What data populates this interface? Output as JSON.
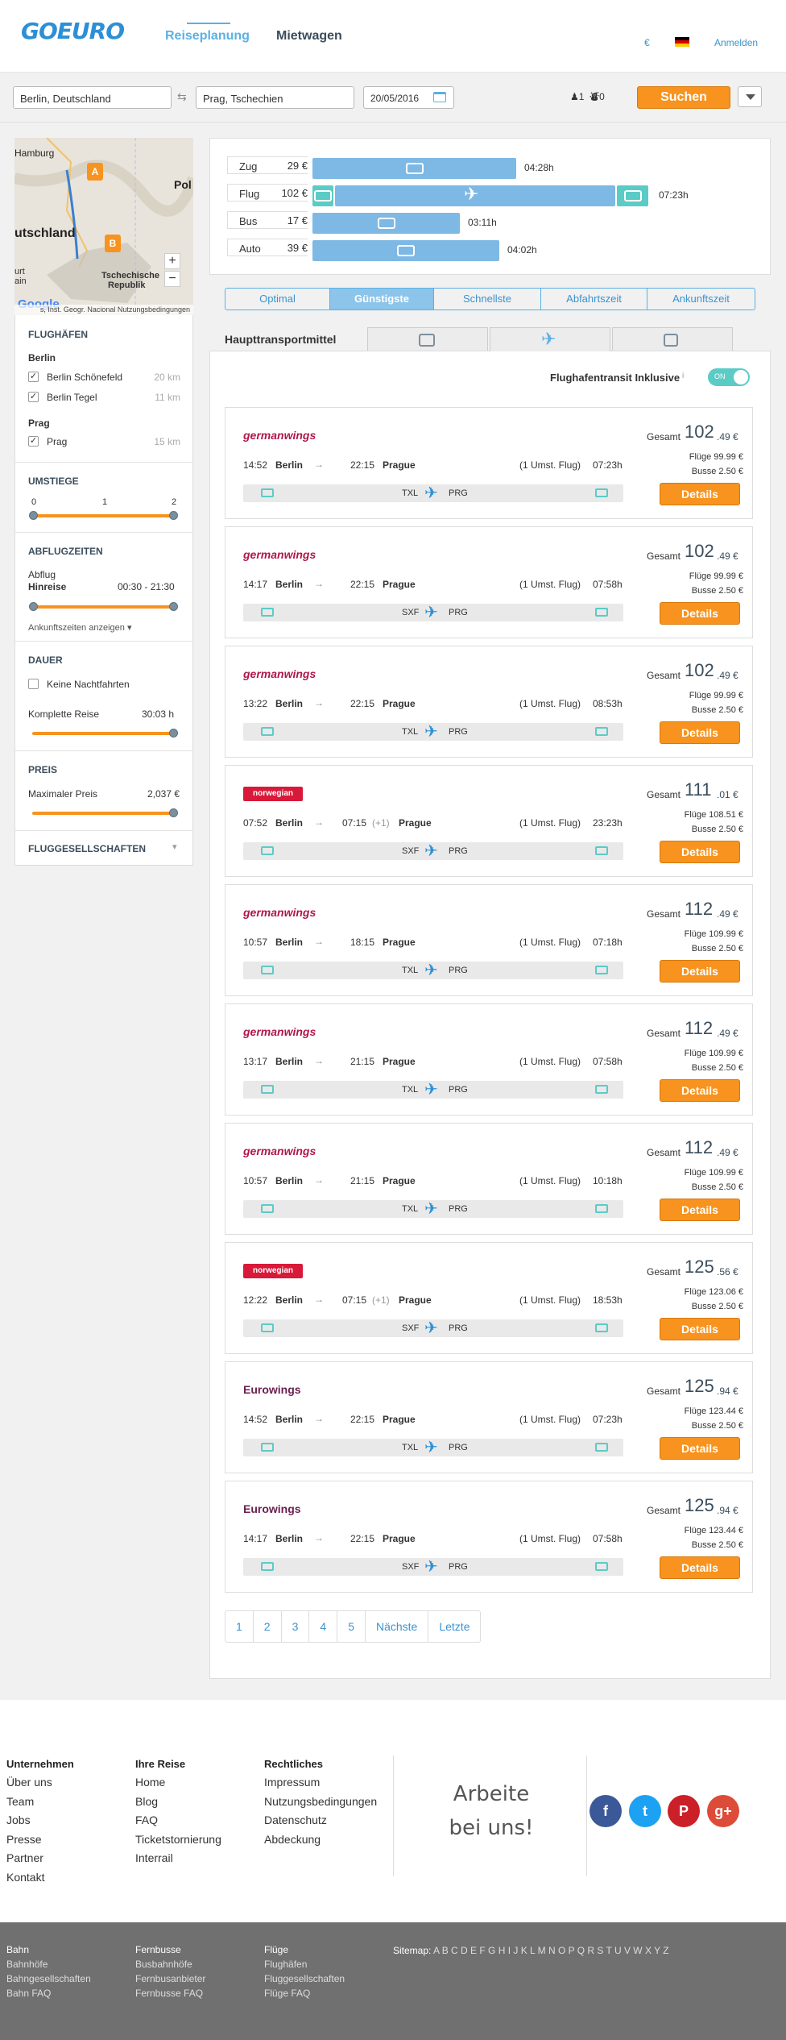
{
  "header": {
    "logo": "GOEURO",
    "nav_reise": "Reiseplanung",
    "nav_miet": "Mietwagen",
    "currency": "€",
    "login": "Anmelden"
  },
  "search": {
    "from": "Berlin, Deutschland",
    "to": "Prag, Tschechien",
    "date": "20/05/2016",
    "pax_count": "1",
    "bag_count": "0",
    "search_label": "Suchen"
  },
  "map": {
    "labels": [
      "Hamburg",
      "Pol",
      "utschland",
      "Tschechische",
      "Republik",
      "urt",
      "ain"
    ],
    "markers": [
      "A",
      "B"
    ],
    "zoom_in": "+",
    "zoom_out": "−",
    "attribution": "s, Inst. Geogr. Nacional   Nutzungsbedingungen",
    "google": "Google"
  },
  "sidebar": {
    "airports_head": "FLUGHÄFEN",
    "groups": [
      {
        "name": "Berlin",
        "items": [
          {
            "label": "Berlin Schönefeld",
            "km": "20 km"
          },
          {
            "label": "Berlin Tegel",
            "km": "11 km"
          }
        ]
      },
      {
        "name": "Prag",
        "items": [
          {
            "label": "Prag",
            "km": "15 km"
          }
        ]
      }
    ],
    "stops_head": "UMSTIEGE",
    "stops_ticks": [
      "0",
      "1",
      "2"
    ],
    "dep_head": "ABFLUGZEITEN",
    "dep_label": "Abflug",
    "dep_sub": "Hinreise",
    "dep_range": "00:30  -  21:30",
    "arrival_link": "Ankunftszeiten anzeigen",
    "dur_head": "DAUER",
    "no_night": "Keine Nachtfahrten",
    "trip_label": "Komplette Reise",
    "trip_value": "30:03 h",
    "price_head": "PREIS",
    "max_label": "Maximaler Preis",
    "max_value": "2,037 €",
    "airlines_head": "FLUGGESELLSCHAFTEN"
  },
  "modes": [
    {
      "label": "Zug",
      "price": "29 €",
      "duration": "04:28h",
      "fill": 0.61
    },
    {
      "label": "Flug",
      "price": "102 €",
      "duration": "07:23h",
      "fill": 1.0
    },
    {
      "label": "Bus",
      "price": "17 €",
      "duration": "03:11h",
      "fill": 0.44
    },
    {
      "label": "Auto",
      "price": "39 €",
      "duration": "04:02h",
      "fill": 0.56
    }
  ],
  "sort_tabs": [
    "Optimal",
    "Günstigste",
    "Schnellste",
    "Abfahrtszeit",
    "Ankunftszeit"
  ],
  "sort_active": "Günstigste",
  "transport": {
    "label": "Haupttransportmittel"
  },
  "transit": {
    "label": "Flughafentransit Inklusive",
    "info": "i",
    "toggle": "ON"
  },
  "results": [
    {
      "airline": "germanwings",
      "type": "gw",
      "dep": "14:52",
      "from": "Berlin",
      "arr": "22:15",
      "plus": "",
      "to": "Prague",
      "stops": "(1 Umst. Flug)",
      "dur": "07:23h",
      "a1": "TXL",
      "a2": "PRG",
      "total_label": "Gesamt",
      "total_int": "102",
      "total_dec": ".49 €",
      "flights": "Flüge 99.99 €",
      "bus": "Busse 2.50 €",
      "btn": "Details"
    },
    {
      "airline": "germanwings",
      "type": "gw",
      "dep": "14:17",
      "from": "Berlin",
      "arr": "22:15",
      "plus": "",
      "to": "Prague",
      "stops": "(1 Umst. Flug)",
      "dur": "07:58h",
      "a1": "SXF",
      "a2": "PRG",
      "total_label": "Gesamt",
      "total_int": "102",
      "total_dec": ".49 €",
      "flights": "Flüge 99.99 €",
      "bus": "Busse 2.50 €",
      "btn": "Details"
    },
    {
      "airline": "germanwings",
      "type": "gw",
      "dep": "13:22",
      "from": "Berlin",
      "arr": "22:15",
      "plus": "",
      "to": "Prague",
      "stops": "(1 Umst. Flug)",
      "dur": "08:53h",
      "a1": "TXL",
      "a2": "PRG",
      "total_label": "Gesamt",
      "total_int": "102",
      "total_dec": ".49 €",
      "flights": "Flüge 99.99 €",
      "bus": "Busse 2.50 €",
      "btn": "Details"
    },
    {
      "airline": "norwegian",
      "type": "nw",
      "dep": "07:52",
      "from": "Berlin",
      "arr": "07:15",
      "plus": "(+1)",
      "to": "Prague",
      "stops": "(1 Umst. Flug)",
      "dur": "23:23h",
      "a1": "SXF",
      "a2": "PRG",
      "total_label": "Gesamt",
      "total_int": "111",
      "total_dec": ".01 €",
      "flights": "Flüge 108.51 €",
      "bus": "Busse 2.50 €",
      "btn": "Details"
    },
    {
      "airline": "germanwings",
      "type": "gw",
      "dep": "10:57",
      "from": "Berlin",
      "arr": "18:15",
      "plus": "",
      "to": "Prague",
      "stops": "(1 Umst. Flug)",
      "dur": "07:18h",
      "a1": "TXL",
      "a2": "PRG",
      "total_label": "Gesamt",
      "total_int": "112",
      "total_dec": ".49 €",
      "flights": "Flüge 109.99 €",
      "bus": "Busse 2.50 €",
      "btn": "Details"
    },
    {
      "airline": "germanwings",
      "type": "gw",
      "dep": "13:17",
      "from": "Berlin",
      "arr": "21:15",
      "plus": "",
      "to": "Prague",
      "stops": "(1 Umst. Flug)",
      "dur": "07:58h",
      "a1": "TXL",
      "a2": "PRG",
      "total_label": "Gesamt",
      "total_int": "112",
      "total_dec": ".49 €",
      "flights": "Flüge 109.99 €",
      "bus": "Busse 2.50 €",
      "btn": "Details"
    },
    {
      "airline": "germanwings",
      "type": "gw",
      "dep": "10:57",
      "from": "Berlin",
      "arr": "21:15",
      "plus": "",
      "to": "Prague",
      "stops": "(1 Umst. Flug)",
      "dur": "10:18h",
      "a1": "TXL",
      "a2": "PRG",
      "total_label": "Gesamt",
      "total_int": "112",
      "total_dec": ".49 €",
      "flights": "Flüge 109.99 €",
      "bus": "Busse 2.50 €",
      "btn": "Details"
    },
    {
      "airline": "norwegian",
      "type": "nw",
      "dep": "12:22",
      "from": "Berlin",
      "arr": "07:15",
      "plus": "(+1)",
      "to": "Prague",
      "stops": "(1 Umst. Flug)",
      "dur": "18:53h",
      "a1": "SXF",
      "a2": "PRG",
      "total_label": "Gesamt",
      "total_int": "125",
      "total_dec": ".56 €",
      "flights": "Flüge 123.06 €",
      "bus": "Busse 2.50 €",
      "btn": "Details"
    },
    {
      "airline": "Eurowings",
      "type": "ew",
      "dep": "14:52",
      "from": "Berlin",
      "arr": "22:15",
      "plus": "",
      "to": "Prague",
      "stops": "(1 Umst. Flug)",
      "dur": "07:23h",
      "a1": "TXL",
      "a2": "PRG",
      "total_label": "Gesamt",
      "total_int": "125",
      "total_dec": ".94 €",
      "flights": "Flüge 123.44 €",
      "bus": "Busse 2.50 €",
      "btn": "Details"
    },
    {
      "airline": "Eurowings",
      "type": "ew",
      "dep": "14:17",
      "from": "Berlin",
      "arr": "22:15",
      "plus": "",
      "to": "Prague",
      "stops": "(1 Umst. Flug)",
      "dur": "07:58h",
      "a1": "SXF",
      "a2": "PRG",
      "total_label": "Gesamt",
      "total_int": "125",
      "total_dec": ".94 €",
      "flights": "Flüge 123.44 €",
      "bus": "Busse 2.50 €",
      "btn": "Details"
    }
  ],
  "pager": [
    "1",
    "2",
    "3",
    "4",
    "5",
    "Nächste",
    "Letzte"
  ],
  "footer": {
    "cols": [
      {
        "head": "Unternehmen",
        "links": [
          "Über uns",
          "Team",
          "Jobs",
          "Presse",
          "Partner",
          "Kontakt"
        ]
      },
      {
        "head": "Ihre Reise",
        "links": [
          "Home",
          "Blog",
          "FAQ",
          "Ticketstornierung",
          "Interrail"
        ]
      },
      {
        "head": "Rechtliches",
        "links": [
          "Impressum",
          "Nutzungsbedingungen",
          "Datenschutz",
          "Abdeckung"
        ]
      }
    ],
    "jobs_line1": "Arbeite",
    "jobs_line2": "bei uns!",
    "social": [
      "f",
      "t",
      "P",
      "g+"
    ]
  },
  "subfooter": {
    "cols": [
      {
        "head": "Bahn",
        "links": [
          "Bahnhöfe",
          "Bahngesellschaften",
          "Bahn FAQ"
        ]
      },
      {
        "head": "Fernbusse",
        "links": [
          "Busbahnhöfe",
          "Fernbusanbieter",
          "Fernbusse FAQ"
        ]
      },
      {
        "head": "Flüge",
        "links": [
          "Flughäfen",
          "Fluggesellschaften",
          "Flüge FAQ"
        ]
      }
    ],
    "sitemap_label": "Sitemap:",
    "sitemap_letters": "A B C D E F G H I J K L M N O P Q R S T U V W X Y Z"
  },
  "colors": {
    "accent": "#f7931e",
    "blue": "#2d8fd5",
    "teal": "#5bcbc6",
    "bar": "#7eb8e4"
  }
}
